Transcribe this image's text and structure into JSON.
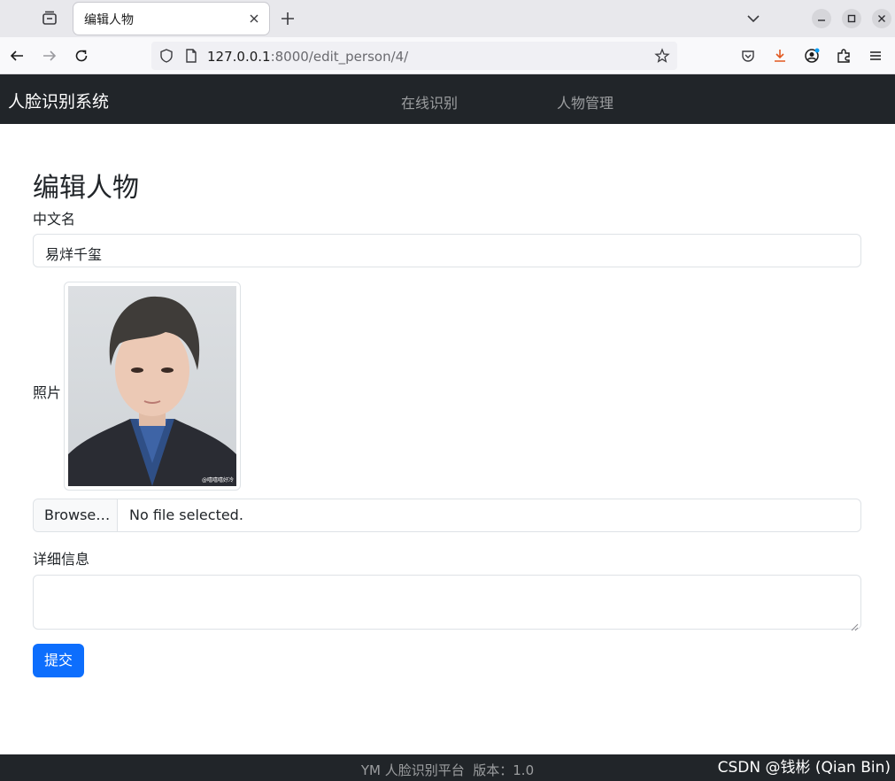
{
  "browser": {
    "tab_title": "编辑人物",
    "url_host": "127.0.0.1",
    "url_rest": ":8000/edit_person/4/"
  },
  "app": {
    "brand": "人脸识别系统",
    "nav": [
      {
        "label": "在线识别"
      },
      {
        "label": "人物管理"
      }
    ]
  },
  "form": {
    "title": "编辑人物",
    "name_label": "中文名",
    "name_value": "易烊千玺",
    "photo_label": "照片",
    "photo_watermark": "@嘻嘻嘻好冷",
    "browse_label": "Browse…",
    "file_status": "No file selected.",
    "details_label": "详细信息",
    "details_value": "",
    "submit_label": "提交"
  },
  "footer": {
    "text": "YM 人脸识别平台  版本：1.0",
    "watermark": "CSDN @钱彬 (Qian Bin)"
  },
  "colors": {
    "primary": "#0d6efd",
    "dark": "#212529"
  }
}
